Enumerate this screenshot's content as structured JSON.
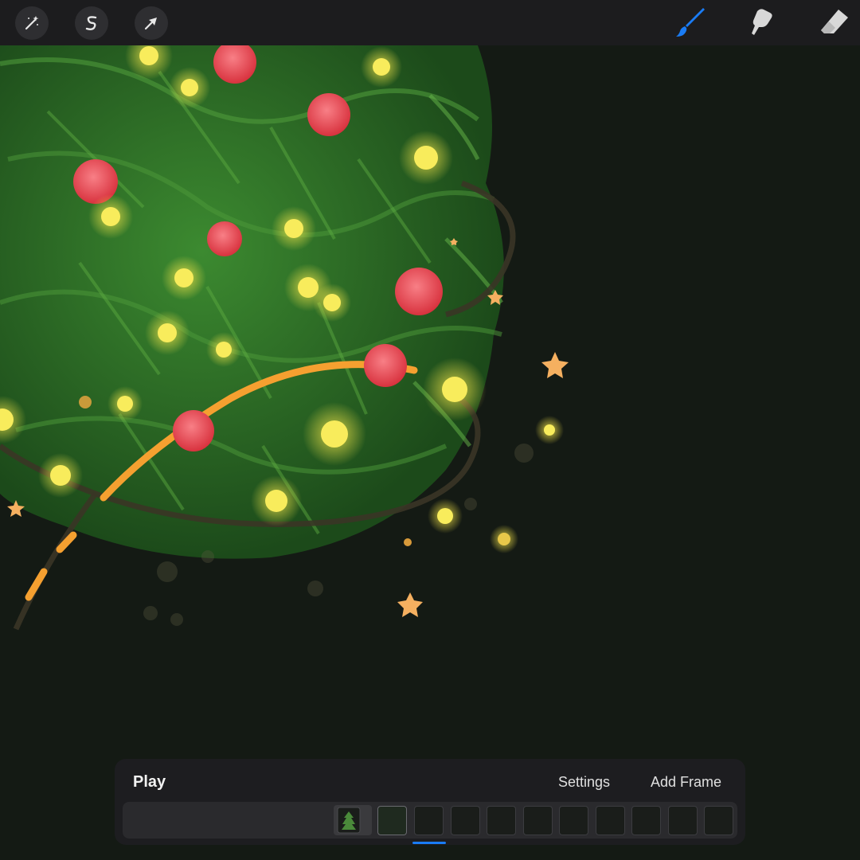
{
  "toolbar": {
    "left_tools": [
      {
        "icon": "magic-wand-icon"
      },
      {
        "icon": "selection-s-icon"
      },
      {
        "icon": "transform-arrow-icon"
      }
    ],
    "right_tools": [
      {
        "icon": "brush-icon",
        "active": true
      },
      {
        "icon": "smudge-icon",
        "active": false
      },
      {
        "icon": "eraser-icon",
        "active": false
      }
    ],
    "accent_color": "#1a7cf5"
  },
  "animation_assist": {
    "play_label": "Play",
    "settings_label": "Settings",
    "add_frame_label": "Add Frame",
    "frame_count": 11,
    "current_frame": 2
  },
  "colors": {
    "background": "#141a14",
    "foliage": "#2f7a2a",
    "ornament": "#e8505a",
    "light": "#f5e64a",
    "ribbon": "#f5a030"
  }
}
